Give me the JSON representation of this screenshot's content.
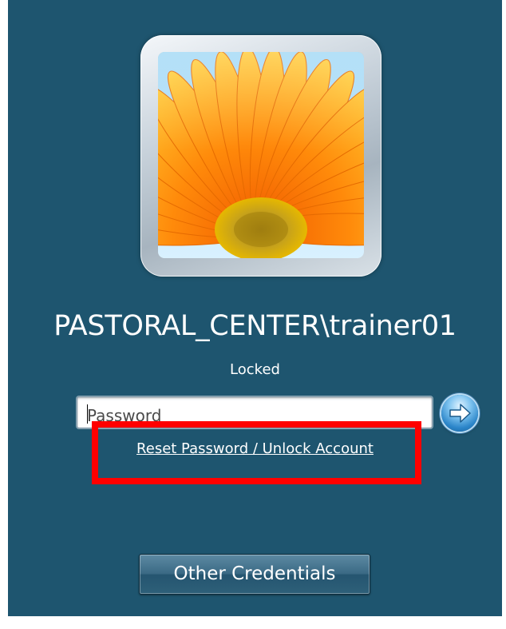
{
  "user": {
    "account_name": "PASTORAL_CENTER\\trainer01",
    "status": "Locked",
    "tile_picture": "orange-gerbera-flower"
  },
  "login": {
    "password_placeholder": "Password",
    "submit_icon": "arrow-right-icon"
  },
  "links": {
    "reset_unlock": "Reset Password / Unlock Account"
  },
  "buttons": {
    "other_credentials": "Other Credentials"
  },
  "colors": {
    "background": "#1e556f",
    "highlight": "#ff0000",
    "text": "#ffffff"
  }
}
